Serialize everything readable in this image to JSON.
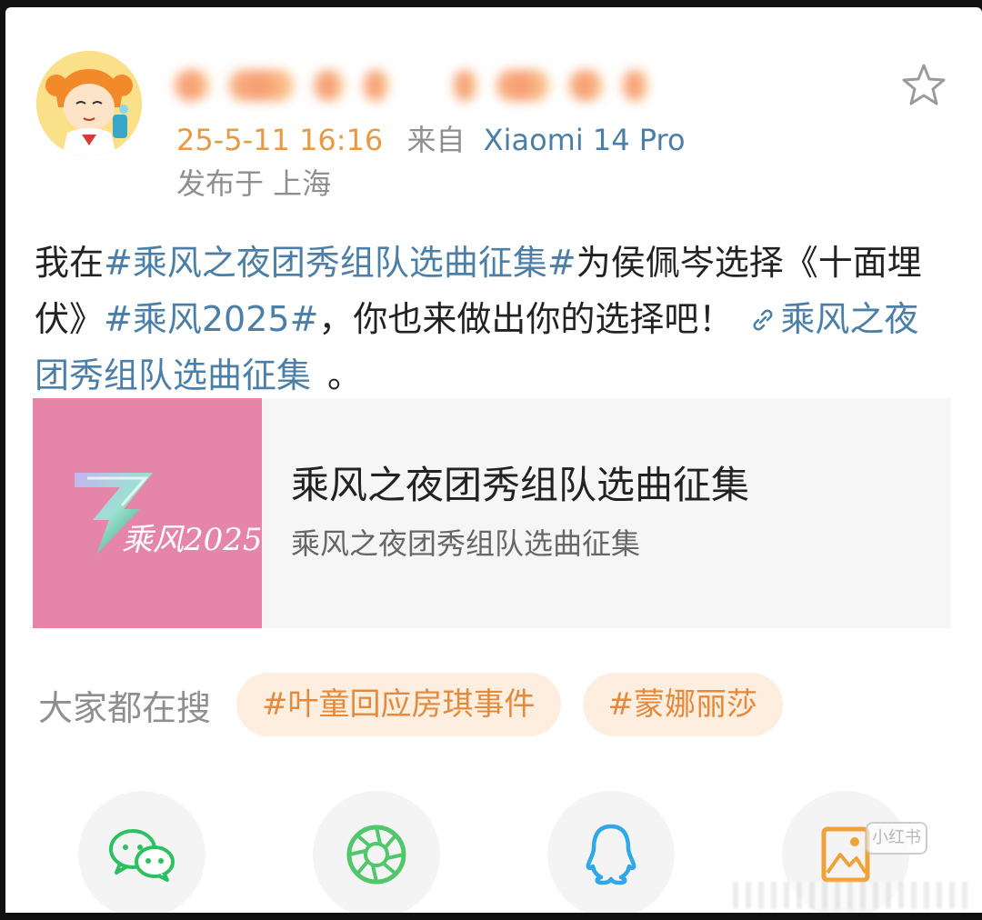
{
  "post": {
    "timestamp": "25-5-11 16:16",
    "from_label": "来自",
    "device": "Xiaomi 14 Pro",
    "location": "发布于 上海",
    "text": {
      "part1": "我在",
      "tag1": "#乘风之夜团秀组队选曲征集#",
      "part2": "为侯佩岑选择《十面埋伏》",
      "tag2": "#乘风2025#",
      "part3": "，你也来做出你的选择吧！",
      "link_label": "乘风之夜团秀组队选曲征集",
      "part4": "。"
    }
  },
  "card": {
    "title": "乘风之夜团秀组队选曲征集",
    "subtitle": "乘风之夜团秀组队选曲征集",
    "logo_text": "乘风2025"
  },
  "search": {
    "label": "大家都在搜",
    "chips": [
      "#叶童回应房琪事件",
      "#蒙娜丽莎"
    ]
  },
  "watermark": {
    "badge": "小红书"
  },
  "colors": {
    "link_blue": "#4c7fa8",
    "time_orange": "#e79a46",
    "chip_bg": "#fdeee0",
    "chip_text": "#e38a3c",
    "card_thumb": "#e586a9",
    "wechat_green": "#2bc160",
    "moments_green": "#4fc76a",
    "qq_blue": "#2fa8e8",
    "save_orange": "#f0a23a"
  },
  "icons": [
    "avatar",
    "star-icon",
    "link-icon",
    "wechat-icon",
    "moments-icon",
    "qq-icon",
    "save-image-icon"
  ]
}
